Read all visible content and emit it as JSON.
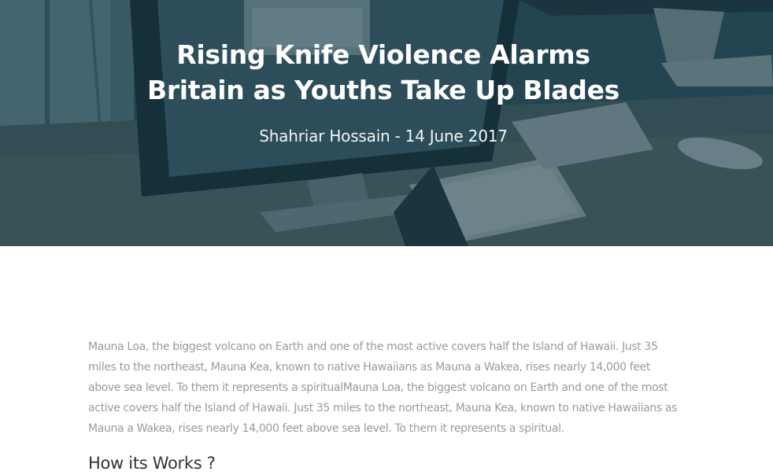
{
  "hero": {
    "title_line1": "Rising Knife Violence Alarms",
    "title_line2": "Britain as Youths Take Up Blades",
    "author": "Shahriar Hossain",
    "separator": "-",
    "date": "14 June 2017",
    "overlay_color": "#103442"
  },
  "article": {
    "paragraph": "Mauna Loa, the biggest volcano on Earth and one of the most active covers half the Island of Hawaii. Just 35 miles to the northeast, Mauna Kea, known to native Hawaiians as Mauna a Wakea, rises nearly 14,000 feet above sea level. To them it represents a spiritualMauna Loa, the biggest volcano on Earth and one of the most active covers half the Island of Hawaii. Just 35 miles to the northeast, Mauna Kea, known to native Hawaiians as Mauna a Wakea, rises nearly 14,000 feet above sea level. To them it represents a spiritual.",
    "section_heading": "How its Works ?"
  }
}
